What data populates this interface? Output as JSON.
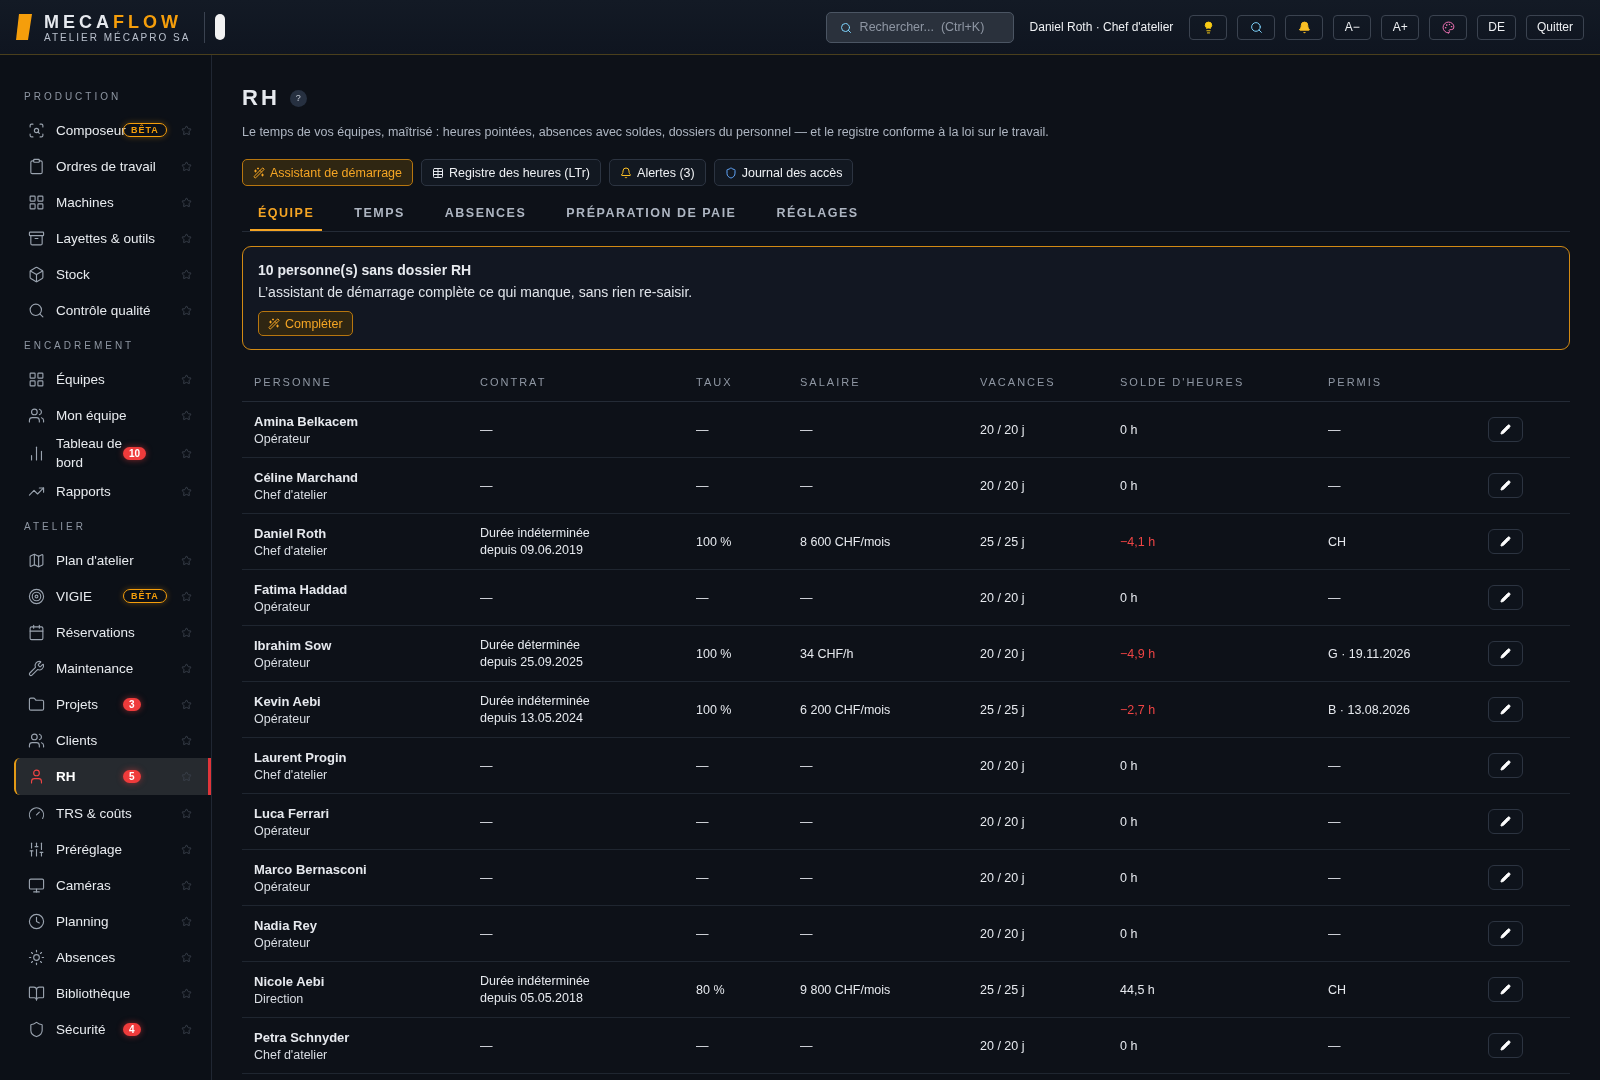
{
  "brand": {
    "name_a": "MECA",
    "name_b": "FLOW",
    "subtitle": "ATELIER MÉCAPRO SA"
  },
  "header": {
    "search": {
      "placeholder": "Rechercher...  (Ctrl+K)"
    },
    "user": "Daniel Roth · Chef d'atelier",
    "buttons": [
      {
        "kind": "idea"
      },
      {
        "kind": "search"
      },
      {
        "kind": "bell"
      },
      {
        "kind": "text",
        "label": "A−"
      },
      {
        "kind": "text",
        "label": "A+"
      },
      {
        "kind": "palette"
      },
      {
        "kind": "text",
        "label": "DE"
      },
      {
        "kind": "text",
        "label": "Quitter"
      }
    ]
  },
  "sidebar": [
    {
      "section": "PRODUCTION",
      "items": [
        {
          "label": "Composeur",
          "beta": "BÊTA",
          "selected": false
        },
        {
          "label": "Ordres de travail",
          "selected": false
        },
        {
          "label": "Machines",
          "selected": false
        },
        {
          "label": "Layettes & outils",
          "selected": false
        },
        {
          "label": "Stock",
          "selected": false
        },
        {
          "label": "Contrôle qualité",
          "selected": false
        }
      ]
    },
    {
      "section": "ENCADREMENT",
      "items": [
        {
          "label": "Équipes",
          "selected": false
        },
        {
          "label": "Mon équipe",
          "selected": false
        },
        {
          "label": "Tableau de bord",
          "badge": "10",
          "selected": false
        },
        {
          "label": "Rapports",
          "selected": false
        }
      ]
    },
    {
      "section": "ATELIER",
      "items": [
        {
          "label": "Plan d'atelier",
          "selected": false
        },
        {
          "label": "VIGIE",
          "beta": "BÊTA",
          "selected": false
        },
        {
          "label": "Réservations",
          "selected": false
        },
        {
          "label": "Maintenance",
          "selected": false
        },
        {
          "label": "Projets",
          "badge": "3",
          "selected": false
        },
        {
          "label": "Clients",
          "selected": false
        },
        {
          "label": "RH",
          "badge": "5",
          "selected": true
        },
        {
          "label": "TRS & coûts",
          "selected": false
        },
        {
          "label": "Préréglage",
          "selected": false
        },
        {
          "label": "Caméras",
          "selected": false
        },
        {
          "label": "Planning",
          "selected": false
        },
        {
          "label": "Absences",
          "selected": false
        },
        {
          "label": "Bibliothèque",
          "selected": false
        },
        {
          "label": "Sécurité",
          "badge": "4",
          "selected": false
        }
      ]
    }
  ],
  "page": {
    "title": "RH",
    "help": "?",
    "description": "Le temps de vos équipes, maîtrisé : heures pointées, absences avec soldes, dossiers du personnel — et le registre conforme à la loi sur le travail.",
    "actions": [
      {
        "kind": "wizard",
        "label": "Assistant de démarrage",
        "primary": true
      },
      {
        "kind": "register",
        "label": "Registre des heures (LTr)",
        "primary": false
      },
      {
        "kind": "bell",
        "label": "Alertes (3)",
        "primary": false
      },
      {
        "kind": "shield",
        "label": "Journal des accès",
        "primary": false
      }
    ],
    "tabs": [
      {
        "label": "ÉQUIPE",
        "selected": true
      },
      {
        "label": "TEMPS",
        "selected": false
      },
      {
        "label": "ABSENCES",
        "selected": false
      },
      {
        "label": "PRÉPARATION DE PAIE",
        "selected": false
      },
      {
        "label": "RÉGLAGES",
        "selected": false
      }
    ],
    "notice": {
      "title": "10 personne(s) sans dossier RH",
      "text": "L’assistant de démarrage complète ce qui manque, sans rien re-saisir.",
      "button": "Compléter"
    }
  },
  "table": {
    "columns": [
      "PERSONNE",
      "CONTRAT",
      "TAUX",
      "SALAIRE",
      "VACANCES",
      "SOLDE D'HEURES",
      "PERMIS"
    ],
    "rows": [
      {
        "name": "Amina Belkacem",
        "role": "Opérateur",
        "contract": [
          "—"
        ],
        "rate": "—",
        "salary": "—",
        "holidays": "20 / 20 j",
        "balance": "0 h",
        "negative": false,
        "permit": "—"
      },
      {
        "name": "Céline Marchand",
        "role": "Chef d'atelier",
        "contract": [
          "—"
        ],
        "rate": "—",
        "salary": "—",
        "holidays": "20 / 20 j",
        "balance": "0 h",
        "negative": false,
        "permit": "—"
      },
      {
        "name": "Daniel Roth",
        "role": "Chef d'atelier",
        "contract": [
          "Durée indéterminée",
          "depuis 09.06.2019"
        ],
        "rate": "100 %",
        "salary": "8 600 CHF/mois",
        "holidays": "25 / 25 j",
        "balance": "−4,1 h",
        "negative": true,
        "permit": "CH"
      },
      {
        "name": "Fatima Haddad",
        "role": "Opérateur",
        "contract": [
          "—"
        ],
        "rate": "—",
        "salary": "—",
        "holidays": "20 / 20 j",
        "balance": "0 h",
        "negative": false,
        "permit": "—"
      },
      {
        "name": "Ibrahim Sow",
        "role": "Opérateur",
        "contract": [
          "Durée déterminée",
          "depuis 25.09.2025"
        ],
        "rate": "100 %",
        "salary": "34 CHF/h",
        "holidays": "20 / 20 j",
        "balance": "−4,9 h",
        "negative": true,
        "permit": "G · 19.11.2026"
      },
      {
        "name": "Kevin Aebi",
        "role": "Opérateur",
        "contract": [
          "Durée indéterminée",
          "depuis 13.05.2024"
        ],
        "rate": "100 %",
        "salary": "6 200 CHF/mois",
        "holidays": "25 / 25 j",
        "balance": "−2,7 h",
        "negative": true,
        "permit": "B · 13.08.2026"
      },
      {
        "name": "Laurent Progin",
        "role": "Chef d'atelier",
        "contract": [
          "—"
        ],
        "rate": "—",
        "salary": "—",
        "holidays": "20 / 20 j",
        "balance": "0 h",
        "negative": false,
        "permit": "—"
      },
      {
        "name": "Luca Ferrari",
        "role": "Opérateur",
        "contract": [
          "—"
        ],
        "rate": "—",
        "salary": "—",
        "holidays": "20 / 20 j",
        "balance": "0 h",
        "negative": false,
        "permit": "—"
      },
      {
        "name": "Marco Bernasconi",
        "role": "Opérateur",
        "contract": [
          "—"
        ],
        "rate": "—",
        "salary": "—",
        "holidays": "20 / 20 j",
        "balance": "0 h",
        "negative": false,
        "permit": "—"
      },
      {
        "name": "Nadia Rey",
        "role": "Opérateur",
        "contract": [
          "—"
        ],
        "rate": "—",
        "salary": "—",
        "holidays": "20 / 20 j",
        "balance": "0 h",
        "negative": false,
        "permit": "—"
      },
      {
        "name": "Nicole Aebi",
        "role": "Direction",
        "contract": [
          "Durée indéterminée",
          "depuis 05.05.2018"
        ],
        "rate": "80 %",
        "salary": "9 800 CHF/mois",
        "holidays": "25 / 25 j",
        "balance": "44,5 h",
        "negative": false,
        "permit": "CH"
      },
      {
        "name": "Petra Schnyder",
        "role": "Chef d'atelier",
        "contract": [
          "—"
        ],
        "rate": "—",
        "salary": "—",
        "holidays": "20 / 20 j",
        "balance": "0 h",
        "negative": false,
        "permit": "—"
      }
    ]
  }
}
